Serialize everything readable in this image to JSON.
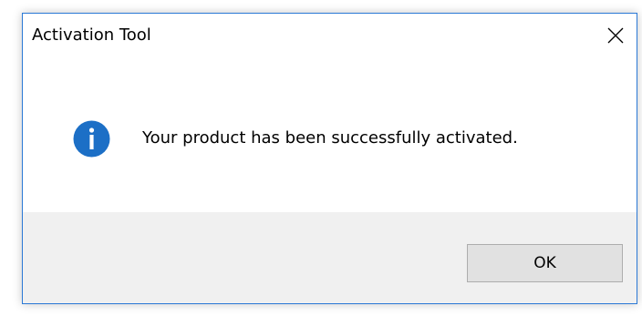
{
  "window": {
    "title": "Activation Tool",
    "accent_color": "#2b79d6"
  },
  "dialog": {
    "icon": "info-icon",
    "icon_color": "#1c6fc6",
    "message": "Your product has been successfully activated.",
    "ok_label": "OK"
  }
}
